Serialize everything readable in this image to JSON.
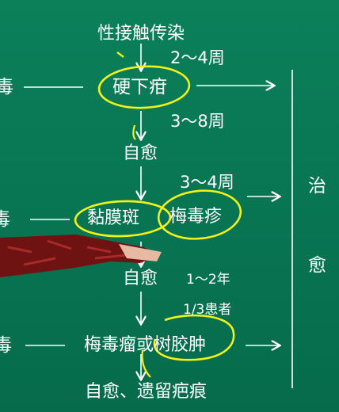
{
  "flow": {
    "top": "性接触传染",
    "interval_1": "2～4周",
    "stage_1": "硬下疳",
    "interval_2": "3～8周",
    "heal_1": "自愈",
    "interval_3": "3～4周",
    "stage_2a": "黏膜斑",
    "stage_2b": "梅毒疹",
    "heal_2": "自愈",
    "interval_4": "1～2年",
    "fraction": "1/3患者",
    "stage_3": "梅毒瘤或树胶肿",
    "final": "自愈、遗留疤痕"
  },
  "side": {
    "left_1": "毒",
    "left_2": "毒",
    "left_3": "毒",
    "right_top": "治",
    "right_bottom": "愈"
  },
  "colors": {
    "background": "#0a7a55",
    "text": "#ffffff",
    "highlight": "#f2f21a",
    "sleeve": "#6e1212"
  }
}
